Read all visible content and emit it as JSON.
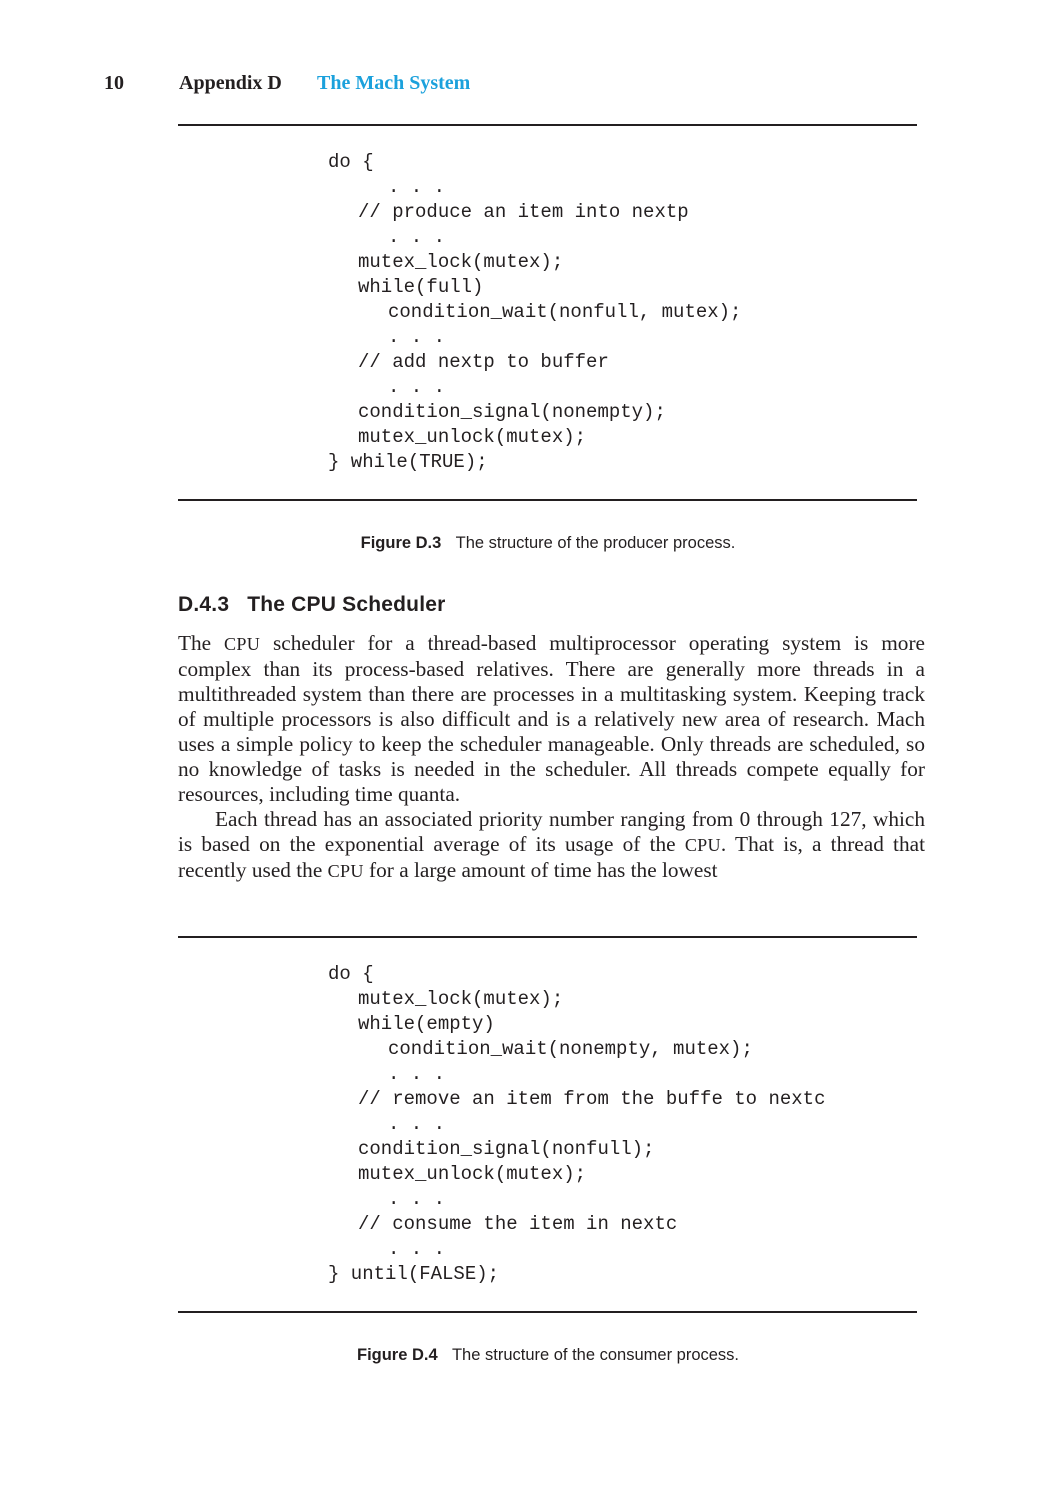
{
  "running_head": {
    "page_number": "10",
    "appendix": "Appendix D",
    "chapter_title": "The Mach System",
    "chapter_color": "#1ba1dc"
  },
  "figure_d3": {
    "code_lines": [
      {
        "indent": 0,
        "text": "do {"
      },
      {
        "indent": 2,
        "text": ". . ."
      },
      {
        "indent": 1,
        "text": "// produce an item into nextp"
      },
      {
        "indent": 2,
        "text": ". . ."
      },
      {
        "indent": 1,
        "text": "mutex_lock(mutex);"
      },
      {
        "indent": 1,
        "text": "while(full)"
      },
      {
        "indent": 2,
        "text": "condition_wait(nonfull, mutex);"
      },
      {
        "indent": 2,
        "text": ". . ."
      },
      {
        "indent": 1,
        "text": "// add nextp to buffer"
      },
      {
        "indent": 2,
        "text": ". . ."
      },
      {
        "indent": 1,
        "text": "condition_signal(nonempty);"
      },
      {
        "indent": 1,
        "text": "mutex_unlock(mutex);"
      },
      {
        "indent": 0,
        "text": "} while(TRUE);"
      }
    ],
    "caption_label": "Figure D.3",
    "caption_text": "The structure of the producer process."
  },
  "section": {
    "number": "D.4.3",
    "title": "The CPU Scheduler"
  },
  "paragraphs": [
    {
      "indent": false,
      "segments": [
        {
          "text": "The ",
          "sc": false
        },
        {
          "text": "CPU",
          "sc": true
        },
        {
          "text": " scheduler for a thread-based multiprocessor operating system is more complex than its process-based relatives. There are generally more threads in a multithreaded system than there are processes in a multitasking system. Keeping track of multiple processors is also difficult and is a relatively new area of research. Mach uses a simple policy to keep the scheduler manageable. Only threads are scheduled, so no knowledge of tasks is needed in the scheduler. All threads compete equally for resources, including time quanta.",
          "sc": false
        }
      ]
    },
    {
      "indent": true,
      "segments": [
        {
          "text": "Each thread has an associated priority number ranging from 0 through 127, which is based on the exponential average of its usage of the ",
          "sc": false
        },
        {
          "text": "CPU",
          "sc": true
        },
        {
          "text": ". That is, a thread that recently used the ",
          "sc": false
        },
        {
          "text": "CPU",
          "sc": true
        },
        {
          "text": " for a large amount of time has the lowest",
          "sc": false
        }
      ]
    }
  ],
  "figure_d4": {
    "code_lines": [
      {
        "indent": 0,
        "text": "do {"
      },
      {
        "indent": 1,
        "text": "mutex_lock(mutex);"
      },
      {
        "indent": 1,
        "text": "while(empty)"
      },
      {
        "indent": 2,
        "text": "condition_wait(nonempty, mutex);"
      },
      {
        "indent": 2,
        "text": ". . ."
      },
      {
        "indent": 1,
        "text": "// remove an item from the buffe to nextc"
      },
      {
        "indent": 2,
        "text": ". . ."
      },
      {
        "indent": 1,
        "text": "condition_signal(nonfull);"
      },
      {
        "indent": 1,
        "text": "mutex_unlock(mutex);"
      },
      {
        "indent": 2,
        "text": ". . ."
      },
      {
        "indent": 1,
        "text": "// consume the item in nextc"
      },
      {
        "indent": 2,
        "text": ". . ."
      },
      {
        "indent": 0,
        "text": "} until(FALSE);"
      }
    ],
    "caption_label": "Figure D.4",
    "caption_text": "The structure of the consumer process."
  }
}
